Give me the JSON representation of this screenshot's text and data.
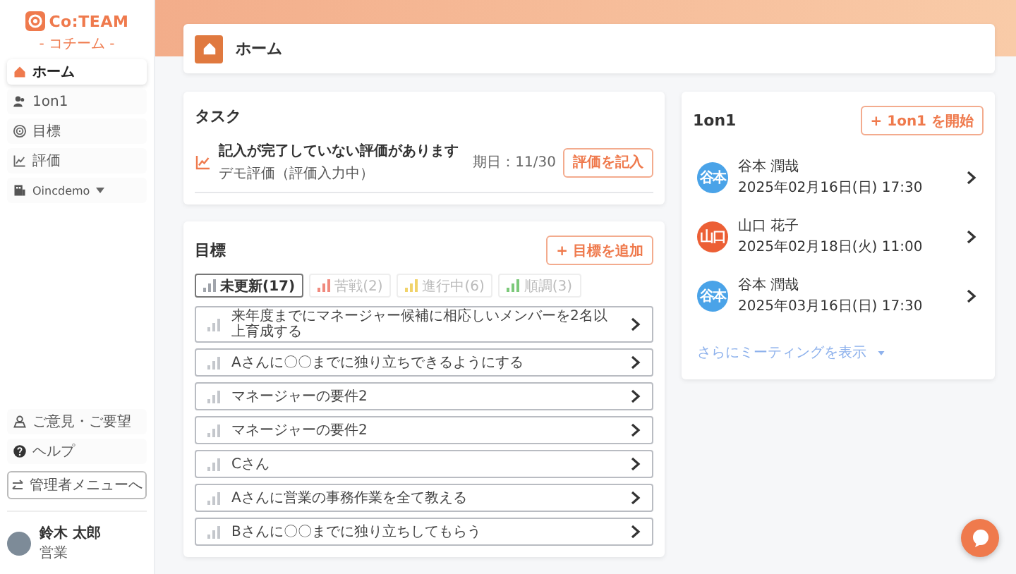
{
  "logo": {
    "name": "Co:TEAM",
    "tagline": "- コチーム -"
  },
  "sidebar": {
    "items": [
      {
        "label": "ホーム",
        "kind": "link",
        "selected": true
      },
      {
        "label": "1on1",
        "kind": "link",
        "selected": false
      },
      {
        "label": "目標",
        "kind": "link",
        "selected": false
      },
      {
        "label": "評価",
        "kind": "link",
        "selected": false
      },
      {
        "label": "Oincdemo",
        "kind": "dropdown",
        "selected": false
      }
    ],
    "footer_items": [
      {
        "label": "ご意見・ご要望"
      },
      {
        "label": "ヘルプ"
      }
    ],
    "admin_button": "管理者メニューへ",
    "user": {
      "name": "鈴木 太郎",
      "role": "営業"
    }
  },
  "header": {
    "title": "ホーム"
  },
  "task": {
    "title": "タスク",
    "items": [
      {
        "title": "記入が完了していない評価があります",
        "subtitle": "デモ評価（評価入力中）",
        "due": "期日：11/30",
        "button": "評価を記入"
      }
    ]
  },
  "goals": {
    "title": "目標",
    "add_button": "+ 目標を追加",
    "filters": [
      {
        "label": "未更新(17)",
        "color": "#a0a4ab",
        "selected": true
      },
      {
        "label": "苦戦(2)",
        "color": "#f08a7e",
        "selected": false
      },
      {
        "label": "進行中(6)",
        "color": "#f1d36a",
        "selected": false
      },
      {
        "label": "順調(3)",
        "color": "#7cc97a",
        "selected": false
      }
    ],
    "items": [
      "来年度までにマネージャー候補に相応しいメンバーを2名以上育成する",
      "Aさんに〇〇までに独り立ちできるようにする",
      "マネージャーの要件2",
      "マネージャーの要件2",
      "Cさん",
      "Aさんに営業の事務作業を全て教える",
      "Bさんに〇〇までに独り立ちしてもらう"
    ]
  },
  "one_on_one": {
    "title": "1on1",
    "start_button": "+ 1on1 を開始",
    "meetings": [
      {
        "avatar_text": "谷本",
        "color": "#4aa3e8",
        "name": "谷本 潤哉",
        "datetime": "2025年02月16日(日) 17:30"
      },
      {
        "avatar_text": "山口",
        "color": "#ec5f35",
        "name": "山口 花子",
        "datetime": "2025年02月18日(火) 11:00"
      },
      {
        "avatar_text": "谷本",
        "color": "#4aa3e8",
        "name": "谷本 潤哉",
        "datetime": "2025年03月16日(日) 17:30"
      }
    ],
    "more_link": "さらにミーティングを表示"
  }
}
